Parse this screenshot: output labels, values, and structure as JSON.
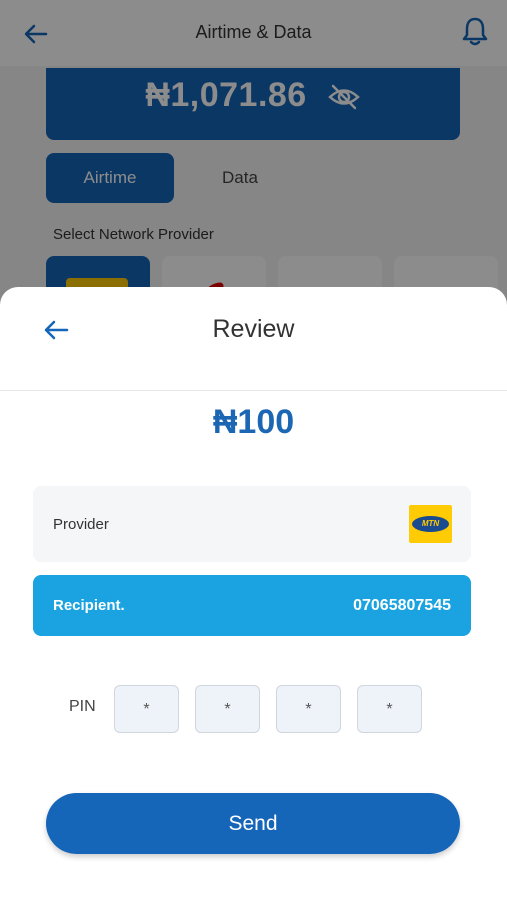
{
  "background": {
    "title": "Airtime & Data",
    "balance": "₦1,071.86",
    "tabs": [
      "Airtime",
      "Data"
    ],
    "select_label": "Select Network Provider"
  },
  "review": {
    "title": "Review",
    "amount": "₦100",
    "provider_label": "Provider",
    "provider_logo_text": "MTN",
    "recipient_label": "Recipient.",
    "recipient_value": "07065807545",
    "pin_label": "PIN",
    "pin_digits": [
      "*",
      "*",
      "*",
      "*"
    ],
    "send_label": "Send"
  },
  "colors": {
    "primary": "#1565b9",
    "recipient_bg": "#1aa3e0",
    "mtn_yellow": "#ffcb05"
  },
  "icons": [
    "back-arrow-icon",
    "bell-icon",
    "eye-off-icon",
    "mtn-logo",
    "airtel-logo",
    "glo-logo",
    "9mobile-logo"
  ]
}
